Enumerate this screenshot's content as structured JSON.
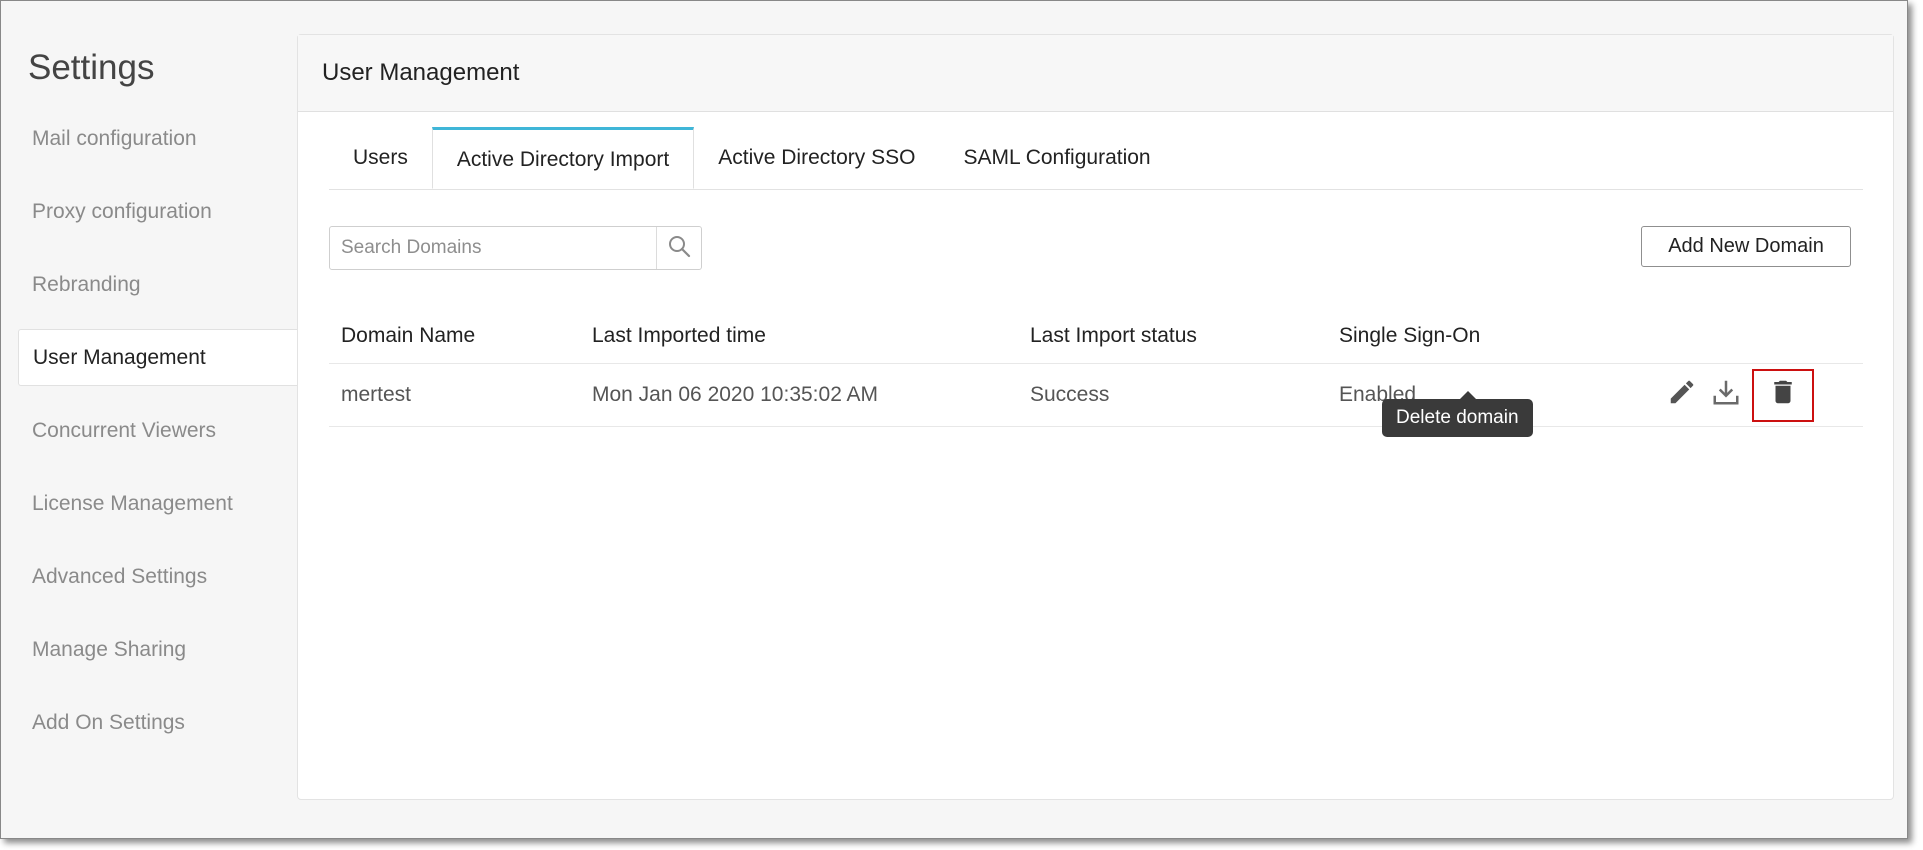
{
  "sidebar": {
    "title": "Settings",
    "items": [
      {
        "label": "Mail configuration",
        "active": false
      },
      {
        "label": "Proxy configuration",
        "active": false
      },
      {
        "label": "Rebranding",
        "active": false
      },
      {
        "label": "User Management",
        "active": true
      },
      {
        "label": "Concurrent Viewers",
        "active": false
      },
      {
        "label": "License Management",
        "active": false
      },
      {
        "label": "Advanced Settings",
        "active": false
      },
      {
        "label": "Manage Sharing",
        "active": false
      },
      {
        "label": "Add On Settings",
        "active": false
      }
    ]
  },
  "panel": {
    "title": "User Management",
    "tabs": [
      {
        "label": "Users",
        "active": false
      },
      {
        "label": "Active Directory Import",
        "active": true
      },
      {
        "label": "Active Directory SSO",
        "active": false
      },
      {
        "label": "SAML Configuration",
        "active": false
      }
    ],
    "search": {
      "placeholder": "Search Domains",
      "value": "",
      "icon": "search-icon"
    },
    "add_button_label": "Add New Domain",
    "table": {
      "columns": [
        "Domain Name",
        "Last Imported time",
        "Last Import status",
        "Single Sign-On"
      ],
      "rows": [
        {
          "domain": "mertest",
          "last_imported": "Mon Jan 06 2020 10:35:02 AM",
          "status": "Success",
          "sso": "Enabled",
          "actions": [
            "edit-icon",
            "download-icon",
            "trash-icon"
          ]
        }
      ]
    },
    "tooltip": "Delete domain"
  },
  "colors": {
    "accent_tab": "#3fb6d8",
    "highlight_box": "#cc1010",
    "tooltip_bg": "#3a3a3a"
  }
}
